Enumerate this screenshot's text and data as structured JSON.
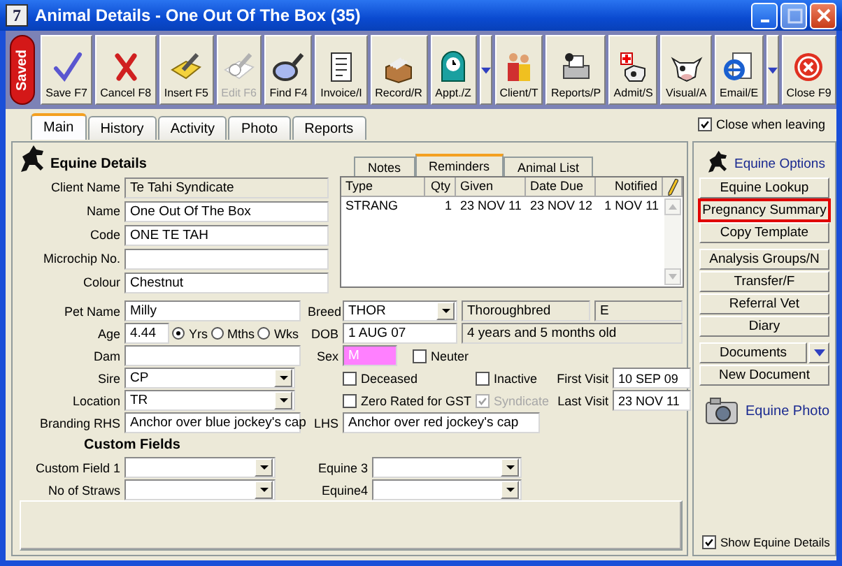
{
  "window": {
    "icon_label": "7",
    "title": "Animal Details - One Out Of The Box (35)"
  },
  "toolbar": {
    "status_badge": "Saved",
    "buttons": [
      {
        "label": "Save F7",
        "disabled": false,
        "menu": false
      },
      {
        "label": "Cancel F8",
        "disabled": false,
        "menu": false
      },
      {
        "label": "Insert F5",
        "disabled": false,
        "menu": false
      },
      {
        "label": "Edit F6",
        "disabled": true,
        "menu": false
      },
      {
        "label": "Find F4",
        "disabled": false,
        "menu": false
      },
      {
        "label": "Invoice/I",
        "disabled": false,
        "menu": false
      },
      {
        "label": "Record/R",
        "disabled": false,
        "menu": false
      },
      {
        "label": "Appt./Z",
        "disabled": false,
        "menu": true
      },
      {
        "label": "Client/T",
        "disabled": false,
        "menu": false
      },
      {
        "label": "Reports/P",
        "disabled": false,
        "menu": false
      },
      {
        "label": "Admit/S",
        "disabled": false,
        "menu": false
      },
      {
        "label": "Visual/A",
        "disabled": false,
        "menu": false
      },
      {
        "label": "Email/E",
        "disabled": false,
        "menu": true
      },
      {
        "label": "Close F9",
        "disabled": false,
        "menu": false
      }
    ]
  },
  "tabs": [
    {
      "label": "Main",
      "selected": true
    },
    {
      "label": "History",
      "selected": false
    },
    {
      "label": "Activity",
      "selected": false
    },
    {
      "label": "Photo",
      "selected": false
    },
    {
      "label": "Reports",
      "selected": false
    }
  ],
  "close_when_leaving": {
    "label": "Close when leaving",
    "checked": true
  },
  "equine_details": {
    "title": "Equine Details",
    "fields": [
      {
        "label": "Client Name",
        "value": "Te Tahi Syndicate",
        "readonly": true
      },
      {
        "label": "Name",
        "value": "One Out Of The Box",
        "readonly": false
      },
      {
        "label": "Code",
        "value": "ONE TE TAH",
        "readonly": false
      },
      {
        "label": "Microchip No.",
        "readonly": false
      },
      {
        "label": "Colour",
        "value": "Chestnut",
        "readonly": false
      }
    ]
  },
  "record_tabs": [
    {
      "label": "Notes",
      "selected": false
    },
    {
      "label": "Reminders",
      "selected": true
    },
    {
      "label": "Animal List",
      "selected": false
    }
  ],
  "reminders": {
    "columns": [
      "Type",
      "Qty",
      "Given",
      "Date Due",
      "Notified"
    ],
    "rows": [
      [
        "STRANG",
        "1",
        "23 NOV 11",
        "23 NOV 12",
        "1 NOV 11"
      ]
    ]
  },
  "pet_name": {
    "label": "Pet Name",
    "value": "Milly"
  },
  "breed": {
    "label": "Breed",
    "value": "THOR",
    "name": "Thoroughbred",
    "code": "E"
  },
  "age": {
    "label": "Age",
    "value": "4.44",
    "units": [
      {
        "label": "Yrs",
        "selected": true
      },
      {
        "label": "Mths",
        "selected": false
      },
      {
        "label": "Wks",
        "selected": false
      }
    ]
  },
  "dob": {
    "label": "DOB",
    "value": "1 AUG 07",
    "age_text": "4 years and 5 months old"
  },
  "dam": {
    "label": "Dam"
  },
  "sex": {
    "label": "Sex",
    "value": "M"
  },
  "neuter": {
    "label": "Neuter",
    "checked": false
  },
  "sire": {
    "label": "Sire",
    "value": "CP"
  },
  "location": {
    "label": "Location",
    "value": "TR"
  },
  "flags": [
    {
      "label": "Deceased",
      "checked": false,
      "disabled": false
    },
    {
      "label": "Inactive",
      "checked": false,
      "disabled": false
    },
    {
      "label": "Zero Rated for GST",
      "checked": false,
      "disabled": false
    },
    {
      "label": "Syndicate",
      "checked": true,
      "disabled": true
    }
  ],
  "first_visit": {
    "label": "First Visit",
    "value": "10 SEP 09"
  },
  "last_visit": {
    "label": "Last Visit",
    "value": "23 NOV 11"
  },
  "branding_rhs": {
    "label": "Branding RHS",
    "value": "Anchor over blue jockey's cap"
  },
  "branding_lhs": {
    "label": "LHS",
    "value": "Anchor over red jockey's cap"
  },
  "custom_fields": {
    "title": "Custom Fields",
    "fields": [
      {
        "label": "Custom Field 1"
      },
      {
        "label": "Equine 3"
      },
      {
        "label": "No of Straws"
      },
      {
        "label": "Equine4"
      }
    ]
  },
  "options": {
    "title": "Equine Options",
    "groups": [
      [
        {
          "label": "Equine Lookup",
          "highlighted": false,
          "menu": false
        },
        {
          "label": "Pregnancy Summary",
          "highlighted": true,
          "menu": false
        },
        {
          "label": "Copy Template",
          "highlighted": false,
          "menu": false
        }
      ],
      [
        {
          "label": "Analysis Groups/N",
          "highlighted": false,
          "menu": false
        },
        {
          "label": "Transfer/F",
          "highlighted": false,
          "menu": false
        },
        {
          "label": "Referral Vet",
          "highlighted": false,
          "menu": false
        },
        {
          "label": "Diary",
          "highlighted": false,
          "menu": false
        }
      ],
      [
        {
          "label": "Documents",
          "highlighted": false,
          "menu": true
        },
        {
          "label": "New Document",
          "highlighted": false,
          "menu": false
        }
      ]
    ],
    "photo_link": "Equine Photo"
  },
  "show_equine_details": {
    "label": "Show Equine Details",
    "checked": true
  }
}
